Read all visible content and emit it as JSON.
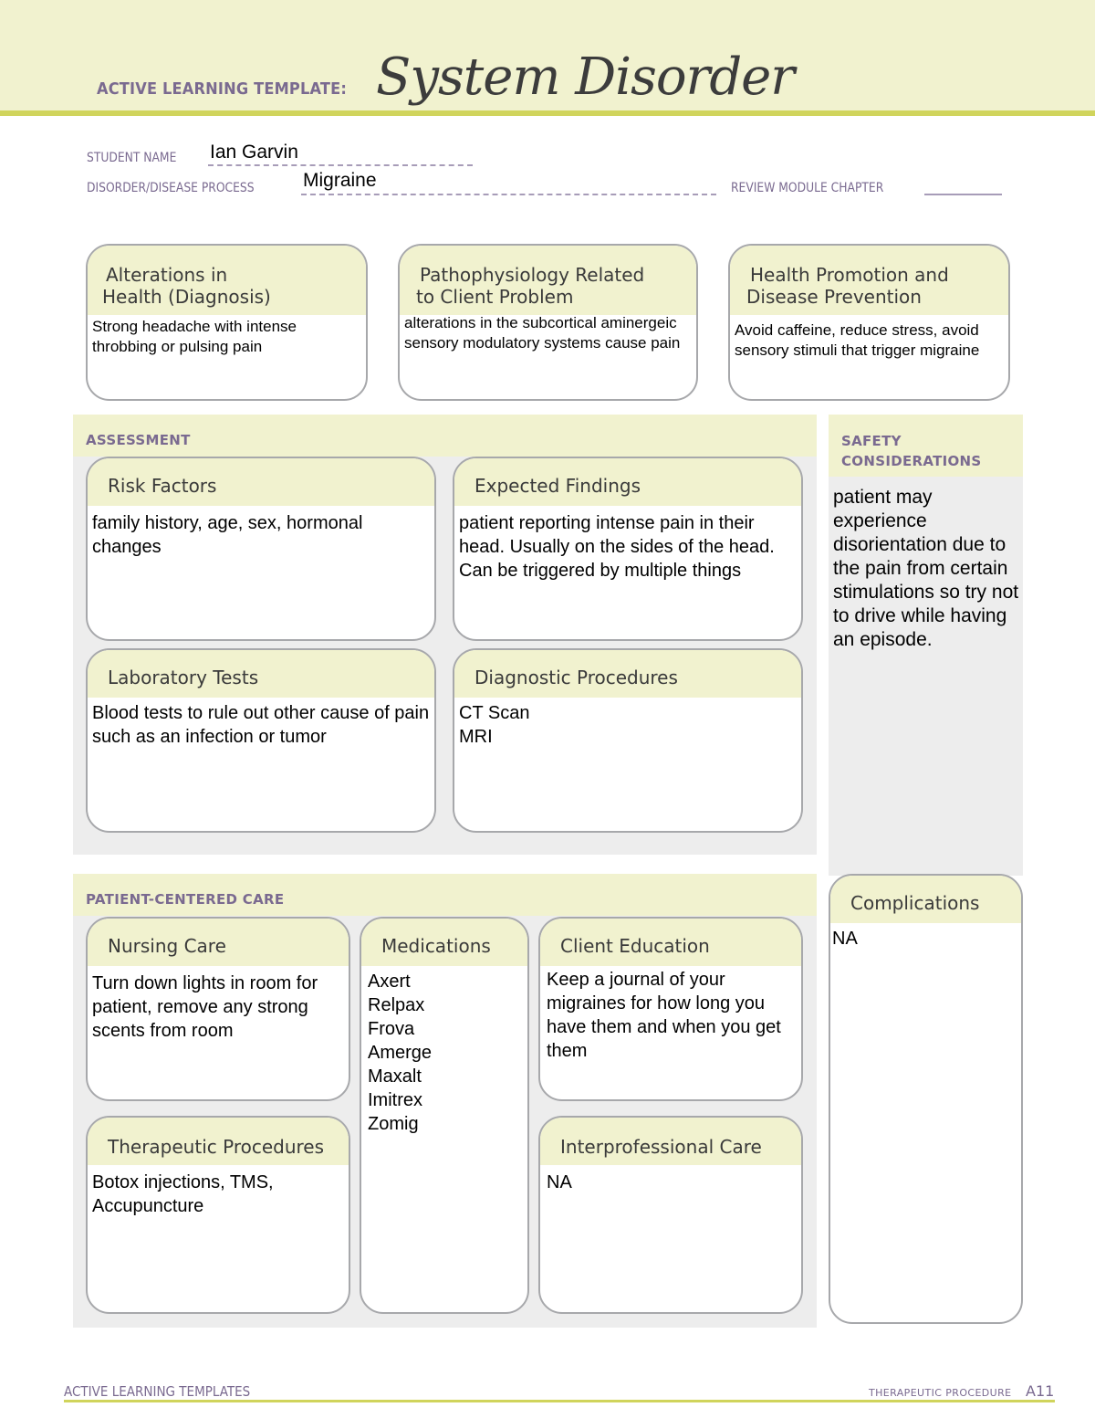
{
  "header": {
    "template_label": "ACTIVE LEARNING TEMPLATE:",
    "title": "System Disorder"
  },
  "fields": {
    "student_name_label": "STUDENT NAME",
    "student_name_value": "Ian Garvin",
    "disorder_label": "DISORDER/DISEASE PROCESS",
    "disorder_value": "Migraine",
    "review_module_label": "REVIEW MODULE CHAPTER",
    "review_module_value": ""
  },
  "top_boxes": {
    "alterations": {
      "title_line1": "Alterations in",
      "title_line2": "Health (Diagnosis)",
      "content": "Strong headache with intense throbbing or pulsing pain"
    },
    "pathophysiology": {
      "title_line1": "Pathophysiology Related",
      "title_line2": "to Client Problem",
      "content": "alterations in the subcortical aminergeic sensory modulatory systems cause pain"
    },
    "health_promotion": {
      "title_line1": "Health Promotion and",
      "title_line2": "Disease Prevention",
      "content": "Avoid caffeine, reduce stress, avoid sensory stimuli that trigger migraine"
    }
  },
  "assessment": {
    "section_label": "ASSESSMENT",
    "risk_factors": {
      "title": "Risk Factors",
      "content": "family history, age, sex, hormonal changes"
    },
    "expected_findings": {
      "title": "Expected Findings",
      "content": "patient reporting intense pain in their head. Usually on the sides of the head. Can be triggered by multiple things"
    },
    "laboratory_tests": {
      "title": "Laboratory Tests",
      "content": "Blood tests to rule out other cause of pain such as an infection or tumor"
    },
    "diagnostic_procedures": {
      "title": "Diagnostic Procedures",
      "items": [
        "CT Scan",
        "MRI"
      ]
    }
  },
  "safety": {
    "section_label_line1": "SAFETY",
    "section_label_line2": "CONSIDERATIONS",
    "content": "patient may experience disorientation due to the pain from certain stimulations so try not to drive while having an episode."
  },
  "patient_centered_care": {
    "section_label": "PATIENT-CENTERED CARE",
    "nursing_care": {
      "title": "Nursing Care",
      "content": "Turn down lights in room for patient, remove any strong scents from room"
    },
    "medications": {
      "title": "Medications",
      "items": [
        "Axert",
        "Relpax",
        "Frova",
        "Amerge",
        "Maxalt",
        "Imitrex",
        "Zomig"
      ]
    },
    "client_education": {
      "title": "Client Education",
      "content": "Keep a journal of your migraines for how long you have them and when you get them"
    },
    "therapeutic_procedures": {
      "title": "Therapeutic Procedures",
      "content": "Botox injections, TMS, Accupuncture"
    },
    "interprofessional_care": {
      "title": "Interprofessional Care",
      "content": "NA"
    }
  },
  "complications": {
    "title": "Complications",
    "content": "NA"
  },
  "footer": {
    "left": "ACTIVE LEARNING TEMPLATES",
    "right_label": "THERAPEUTIC PROCEDURE",
    "page": "A11"
  },
  "colors": {
    "banner_bg": "#f1f2cf",
    "accent_rule": "#d0d45c",
    "label_purple": "#7a6a90",
    "section_gray": "#ededed",
    "box_border": "#a7a8ab"
  }
}
